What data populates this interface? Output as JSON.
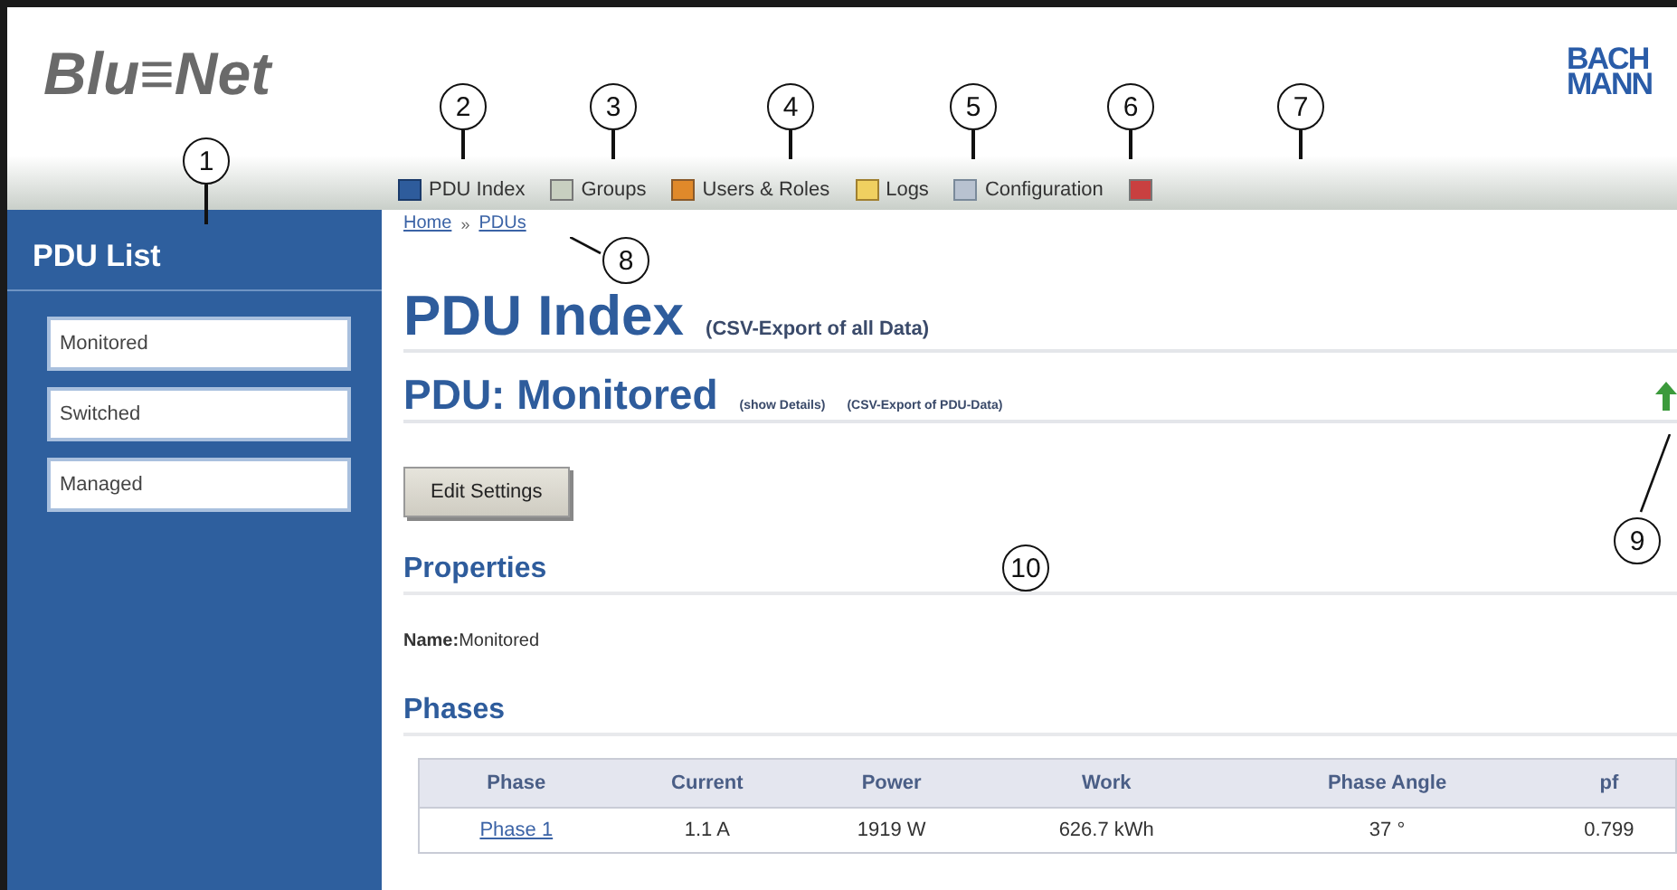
{
  "header": {
    "logo": "Blu≡Net",
    "brand": [
      "BACH",
      "MANN"
    ]
  },
  "nav": [
    {
      "label": "PDU Index",
      "kind": "index"
    },
    {
      "label": "Groups",
      "kind": "groups"
    },
    {
      "label": "Users & Roles",
      "kind": "users"
    },
    {
      "label": "Logs",
      "kind": "logs"
    },
    {
      "label": "Configuration",
      "kind": "config"
    },
    {
      "kind": "logout"
    }
  ],
  "sidebar": {
    "title": "PDU List",
    "items": [
      {
        "label": "Monitored"
      },
      {
        "label": "Switched"
      },
      {
        "label": "Managed"
      }
    ]
  },
  "breadcrumb": {
    "links": [
      "Home",
      "PDUs"
    ],
    "separator": "»"
  },
  "page": {
    "title": "PDU Index",
    "export_link": "(CSV-Export of all Data)"
  },
  "pdu": {
    "title": "PDU: Monitored",
    "links": [
      "(show Details)",
      "(CSV-Export of PDU-Data)"
    ]
  },
  "edit_button": "Edit Settings",
  "properties": {
    "title": "Properties",
    "name_label": "Name:",
    "name_value": "Monitored"
  },
  "phases": {
    "title": "Phases",
    "columns": [
      "Phase",
      "Current",
      "Power",
      "Work",
      "Phase Angle",
      "pf"
    ],
    "rows": [
      [
        "Phase 1",
        "1.1 A",
        "1919 W",
        "626.7 kWh",
        "37 °",
        "0.799"
      ]
    ]
  },
  "callouts": [
    "1",
    "2",
    "3",
    "4",
    "5",
    "6",
    "7",
    "8",
    "9",
    "10"
  ]
}
